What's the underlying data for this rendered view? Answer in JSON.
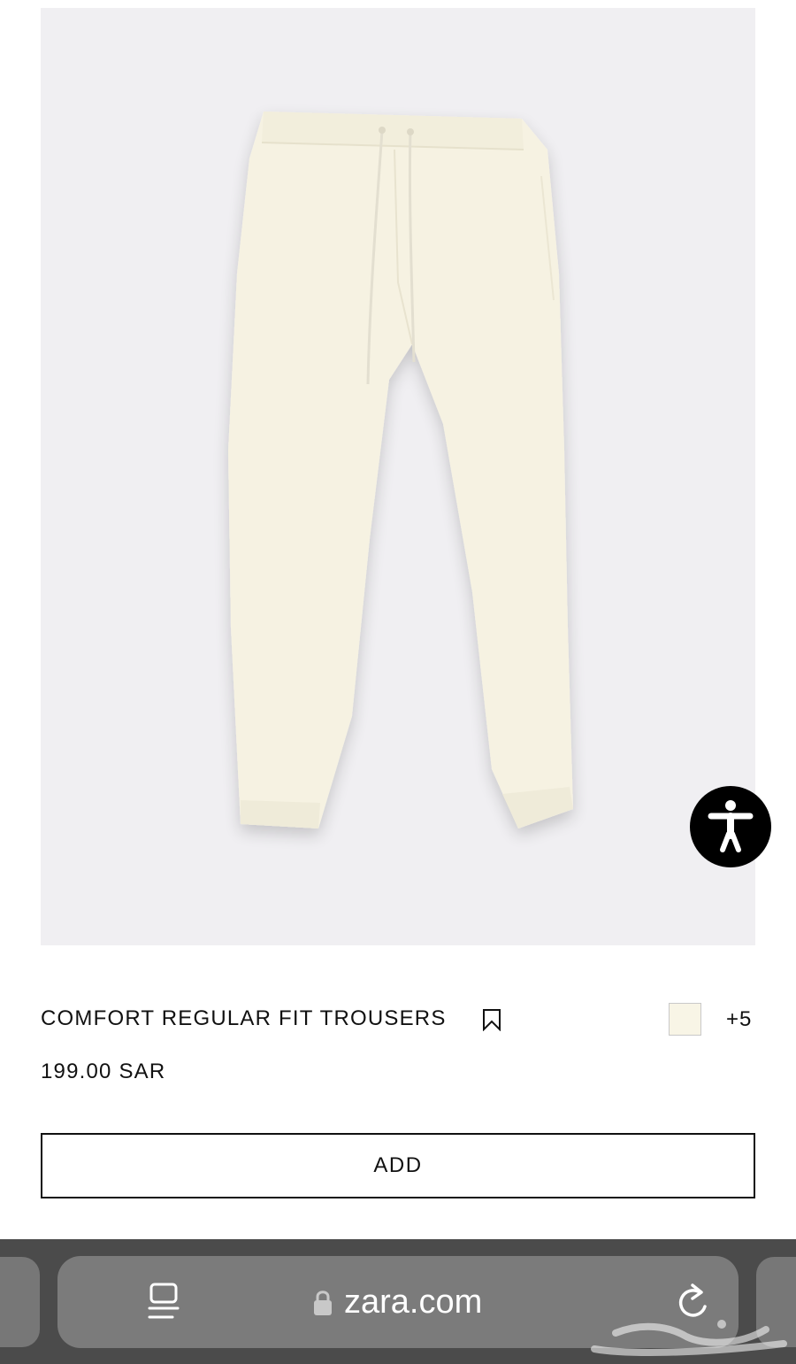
{
  "product": {
    "image_icon": "product-photo-trousers",
    "title": "COMFORT REGULAR FIT TROUSERS",
    "price": "199.00 SAR",
    "selected_color": "#f8f5e6",
    "more_colors_label": "+5",
    "add_label": "ADD",
    "bookmark_icon": "bookmark-icon"
  },
  "accessibility": {
    "icon": "accessibility-icon"
  },
  "browser": {
    "url": "zara.com",
    "page_icon": "page-menu-icon",
    "lock_icon": "lock-icon",
    "reload_icon": "reload-icon"
  },
  "watermark": {
    "text": "حراج"
  },
  "colors": {
    "background": "#ffffff",
    "image_background": "#f0eff2",
    "trousers": "#f6f2e2",
    "text": "#111111",
    "browser_bar": "#4b4b4b",
    "address_bar": "#7b7b7b"
  }
}
